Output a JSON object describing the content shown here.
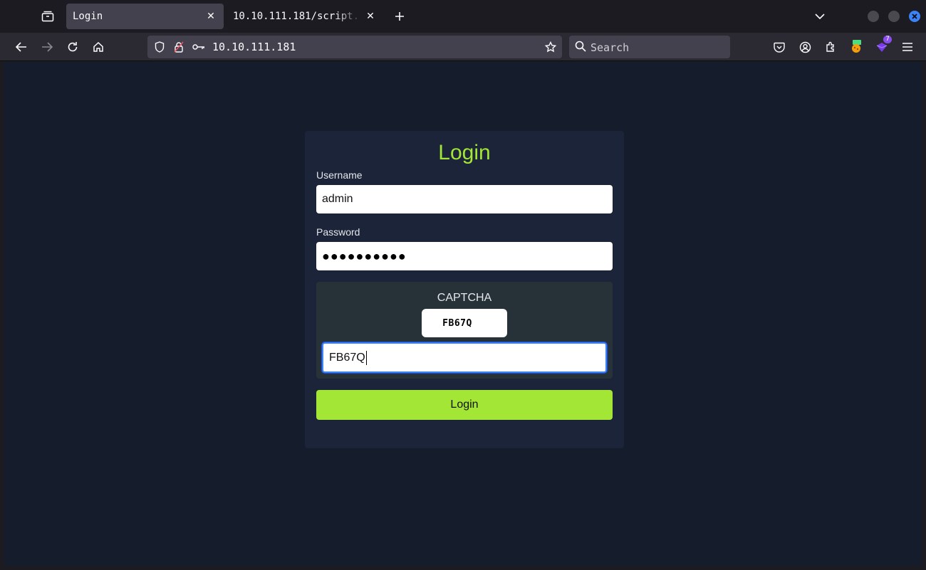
{
  "browser": {
    "tabs": [
      {
        "title": "Login",
        "active": true
      },
      {
        "title": "10.10.111.181/script.",
        "active": false
      }
    ],
    "url": "10.10.111.181",
    "search_placeholder": "Search",
    "extension_badge": "7",
    "icons": [
      "tab-overview-icon",
      "close-icon",
      "plus-icon",
      "chevron-down-icon",
      "back-icon",
      "forward-icon",
      "reload-icon",
      "home-icon",
      "shield-icon",
      "insecure-lock-icon",
      "key-icon",
      "star-icon",
      "search-icon",
      "pocket-icon",
      "account-icon",
      "extensions-icon",
      "menu-icon"
    ],
    "colors": {
      "accent": "#3b82f6",
      "toolbar": "#2b2a33",
      "tab_active": "#42414d"
    }
  },
  "page": {
    "title": "Login",
    "username_label": "Username",
    "username_value": "admin",
    "password_label": "Password",
    "password_value": "●●●●●●●●●●",
    "captcha_heading": "CAPTCHA",
    "captcha_code": "FB67Q",
    "captcha_input_value": "FB67Q",
    "submit_label": "Login",
    "colors": {
      "background": "#151c2c",
      "card": "#1b2439",
      "accent_green": "#a3e635",
      "captcha_panel": "#263238"
    }
  }
}
